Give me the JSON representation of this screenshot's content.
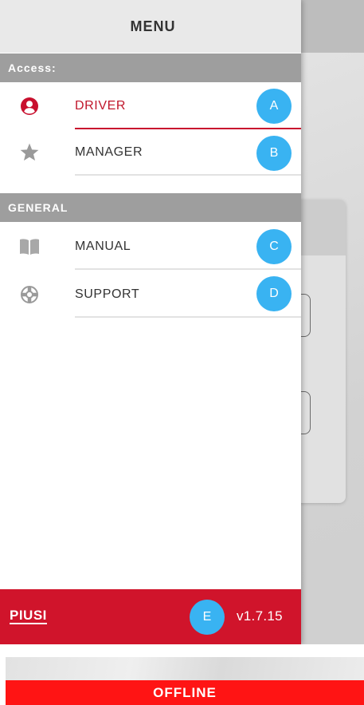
{
  "menu": {
    "title": "MENU"
  },
  "sections": {
    "access": "Access:",
    "general": "GENERAL"
  },
  "items": [
    {
      "label": "DRIVER",
      "icon": "user-circle-icon",
      "badge": "A",
      "active": true
    },
    {
      "label": "MANAGER",
      "icon": "star-icon",
      "badge": "B",
      "active": false
    },
    {
      "label": "MANUAL",
      "icon": "book-icon",
      "badge": "C",
      "active": false
    },
    {
      "label": "SUPPORT",
      "icon": "lifebuoy-icon",
      "badge": "D",
      "active": false
    }
  ],
  "footer": {
    "logo": "PIUSI",
    "badge": "E",
    "version": "v1.7.15"
  },
  "status": {
    "offline": "OFFLINE"
  },
  "colors": {
    "accent_red": "#d0142b",
    "badge_blue": "#39b3f2",
    "offline_red": "#ff1414",
    "section_gray": "#9e9e9e"
  }
}
